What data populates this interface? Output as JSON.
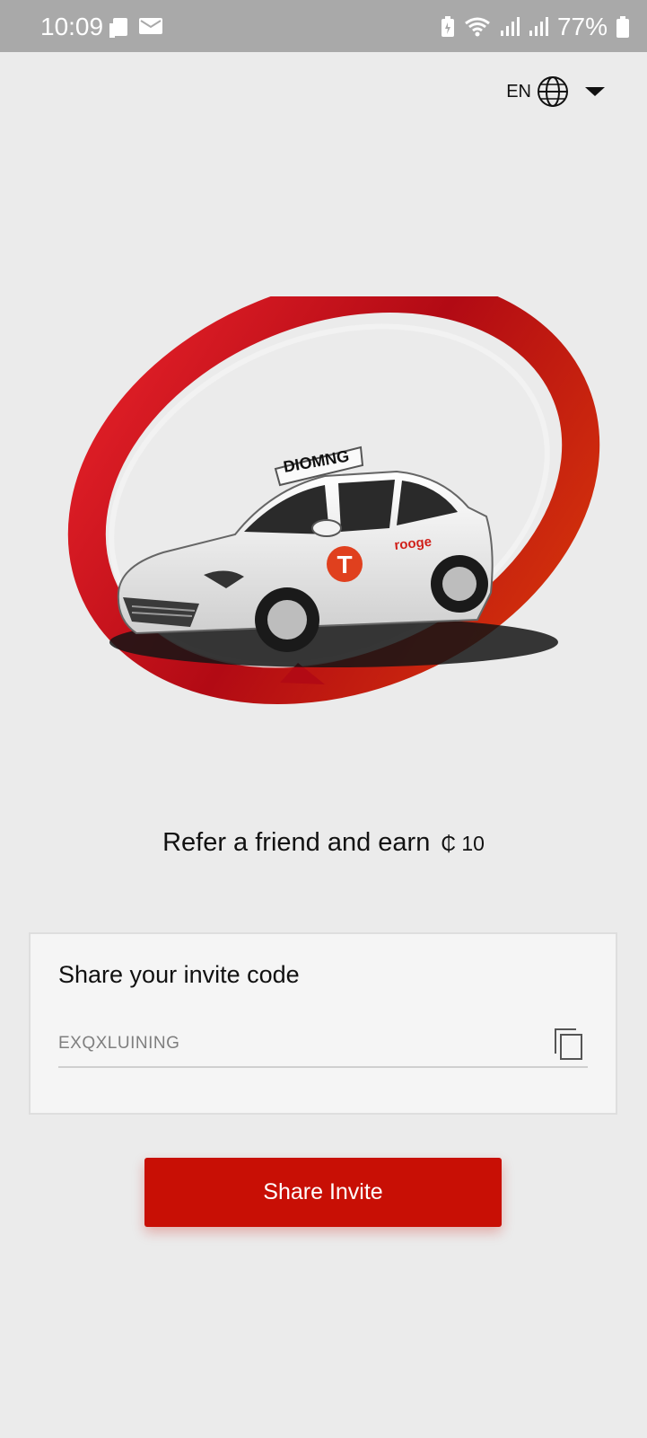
{
  "status_bar": {
    "time": "10:09",
    "battery": "77%",
    "icons": [
      "sim-icon",
      "mail-icon",
      "battery-saver-icon",
      "wifi-icon",
      "signal-icon",
      "signal-icon",
      "battery-icon"
    ]
  },
  "language": {
    "code": "EN",
    "icon": "globe-icon",
    "dropdown_icon": "caret-down-icon"
  },
  "hero": {
    "image_icon": "taxi-illustration",
    "roof_sign": "DIOMNG",
    "door_text": "rooge",
    "logo_letter": "T"
  },
  "referral": {
    "earn_text": "Refer a friend and earn",
    "amount": "₵ 10"
  },
  "invite_card": {
    "title": "Share your invite code",
    "code": "EXQXLUINING",
    "copy_icon": "copy-icon"
  },
  "share_button": {
    "label": "Share Invite"
  },
  "colors": {
    "accent": "#c80f05",
    "background": "#ebebeb",
    "status_bar": "#a9a9a9"
  }
}
